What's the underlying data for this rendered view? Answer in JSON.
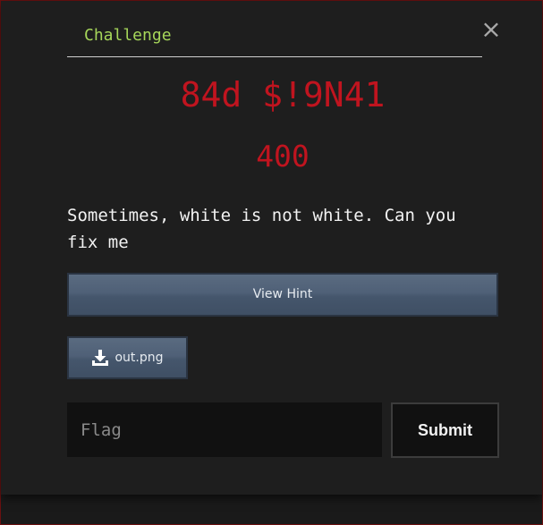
{
  "challenge": {
    "tab_label": "Challenge",
    "close_icon": "close-icon",
    "close_glyph": "×",
    "title": "84d $!9N41",
    "points": "400",
    "description": "Sometimes, white is not white. Can you fix me",
    "hint_button_label": "View Hint",
    "file": {
      "name": "out.png",
      "icon": "download-icon"
    },
    "flag_input": {
      "placeholder": "Flag",
      "value": ""
    },
    "submit_label": "Submit"
  },
  "colors": {
    "accent_green": "#a6d65a",
    "title_red": "#c0141f",
    "button_blue": "#4f6077",
    "background": "#1e1e1e"
  }
}
